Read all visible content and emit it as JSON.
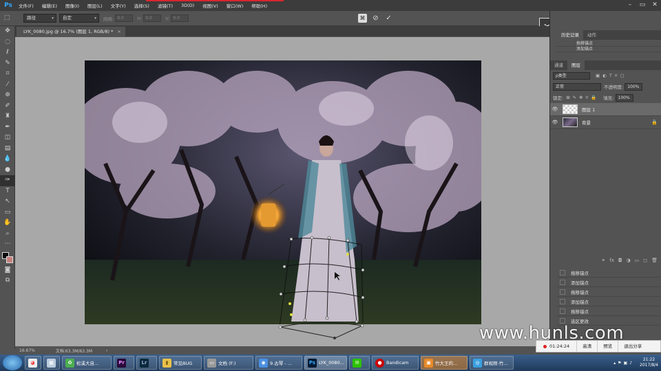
{
  "app": {
    "logo": "Ps",
    "menus": [
      "文件(F)",
      "编辑(E)",
      "图像(I)",
      "图层(L)",
      "文字(Y)",
      "选择(S)",
      "滤镜(T)",
      "3D(D)",
      "视图(V)",
      "窗口(W)",
      "帮助(H)"
    ],
    "window_controls": [
      "–",
      "▭",
      "✕"
    ]
  },
  "options": {
    "mode_value": "路径",
    "preset_value": "自定",
    "density_label": "网格:",
    "density_value": "0.0",
    "h_label": "H:",
    "h_value": "0.0",
    "v_label": "V:",
    "v_value": "0.0",
    "commit_icons": [
      "warp-grid-icon",
      "cancel-icon",
      "commit-check-icon"
    ]
  },
  "document": {
    "tab_title": "LYK_0080.jpg @ 16.7% (图层 1, RGB/8) *",
    "tab_close": "×",
    "zoom": "16.67%",
    "doc_size": "文档:63.3M/63.3M",
    "status_arrow": "›"
  },
  "panels": {
    "history_tabs": [
      "历史记录",
      "动作"
    ],
    "history_top_items": [
      "拖移锚点",
      "添加锚点"
    ],
    "layer_tabs": [
      "通道",
      "图层"
    ],
    "kind_filter": "ρ类型",
    "blend_mode": "正常",
    "opacity_label": "不透明度:",
    "opacity_value": "100%",
    "lock_label": "锁定:",
    "fill_label": "填充:",
    "fill_value": "100%",
    "layers": [
      {
        "name": "图层 1",
        "selected": true
      },
      {
        "name": "背景",
        "selected": false,
        "locked": true
      }
    ],
    "history_bottom_items": [
      "拖移锚点",
      "添加锚点",
      "拖移锚点",
      "添加锚点",
      "拖移锚点",
      "选区更改"
    ]
  },
  "recorder": {
    "time": "01:24:24",
    "buttons": [
      "高清",
      "预览",
      "退出分享"
    ]
  },
  "watermark": "www.hunls.com",
  "taskbar": {
    "items": [
      {
        "label": "松溪大自...",
        "icon": "♻",
        "color": "#4caf50"
      },
      {
        "label": "",
        "icon": "Pr",
        "color": "#2a0a3a"
      },
      {
        "label": "",
        "icon": "Lr",
        "color": "#0a2a3a"
      },
      {
        "label": "常见BUG",
        "icon": "▮",
        "color": "#e8c04a"
      },
      {
        "label": "文档 (F:)",
        "icon": "▭",
        "color": "#999"
      },
      {
        "label": "9.古琴 - ...",
        "icon": "◉",
        "color": "#4a90e2"
      },
      {
        "label": "LYK_0080...",
        "icon": "Ps",
        "color": "#001a33"
      },
      {
        "label": "",
        "icon": "✉",
        "color": "#2dc100"
      },
      {
        "label": "Bandicam",
        "icon": "●",
        "color": "#c00"
      },
      {
        "label": "竹大王的...",
        "icon": "▣",
        "color": "#e88a2a"
      },
      {
        "label": "群视频-竹...",
        "icon": "◎",
        "color": "#3aa0e0"
      }
    ],
    "time": "21:22",
    "date": "2017/8/4"
  }
}
